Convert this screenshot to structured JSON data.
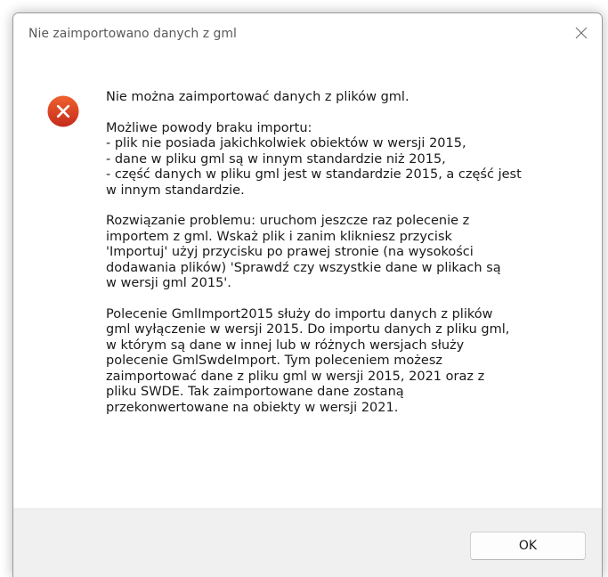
{
  "dialog": {
    "title": "Nie zaimportowano danych z gml",
    "close_icon": "close-icon",
    "icon": "error-icon",
    "colors": {
      "error_icon_top": "#f0622e",
      "error_icon_bottom": "#c42b1c",
      "footer_bg": "#f0f0f0"
    },
    "message": {
      "heading": "Nie można zaimportować danych z plików gml.",
      "reasons": "Możliwe powody braku importu:\n- plik nie posiada jakichkolwiek obiektów w wersji 2015,\n- dane w pliku gml są w innym standardzie niż 2015,\n- część danych w pliku gml jest w standardzie 2015, a część jest\nw innym standardzie.",
      "solution": "Rozwiązanie problemu: uruchom jeszcze raz polecenie z\nimportem z gml. Wskaż plik i zanim klikniesz przycisk\n'Importuj' użyj przycisku po prawej stronie (na wysokości\ndodawania plików) 'Sprawdź czy wszystkie dane w plikach są\nw wersji gml 2015'.",
      "note": "Polecenie GmlImport2015 służy do importu danych z plików\ngml wyłączenie w wersji 2015. Do importu danych z pliku gml,\nw którym są dane w innej lub w różnych wersjach służy\npolecenie GmlSwdeImport. Tym poleceniem możesz\nzaimportować dane z pliku gml w wersji 2015, 2021 oraz z\npliku SWDE. Tak zaimportowane dane zostaną\nprzekonwertowane na obiekty w wersji 2021."
    },
    "ok_label": "OK"
  }
}
